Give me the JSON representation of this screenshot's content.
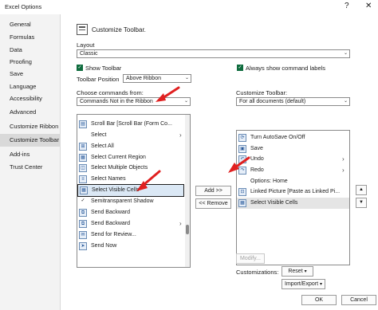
{
  "window": {
    "title": "Excel Options",
    "help": "?",
    "close": "✕"
  },
  "nav": {
    "items": [
      {
        "label": "General"
      },
      {
        "label": "Formulas"
      },
      {
        "label": "Data"
      },
      {
        "label": "Proofing"
      },
      {
        "label": "Save"
      },
      {
        "label": "Language"
      },
      {
        "label": "Accessibility"
      },
      {
        "label": "Advanced"
      },
      {
        "label": "Customize Ribbon"
      },
      {
        "label": "Customize Toolbar"
      },
      {
        "label": "Add-ins"
      },
      {
        "label": "Trust Center"
      }
    ],
    "active": "Customize Toolbar"
  },
  "main": {
    "heading": "Customize Toolbar.",
    "layout_label": "Layout",
    "layout_value": "Classic",
    "show_toolbar": "Show Toolbar",
    "always_show_labels": "Always show command labels",
    "toolbar_position_label": "Toolbar Position",
    "toolbar_position_value": "Above Ribbon",
    "choose_commands_label": "Choose commands from:",
    "choose_commands_value": "Commands Not in the Ribbon",
    "customize_toolbar_label": "Customize Toolbar:",
    "customize_toolbar_value": "For all documents (default)",
    "left_list": [
      {
        "label": "Scroll Bar [Scroll Bar (Form Co...",
        "icon": "scrollbar-icon"
      },
      {
        "label": "Select",
        "icon": "",
        "arrow": "›"
      },
      {
        "label": "Select All",
        "icon": "select-all-icon"
      },
      {
        "label": "Select Current Region",
        "icon": "select-region-icon"
      },
      {
        "label": "Select Multiple Objects",
        "icon": "select-objects-icon"
      },
      {
        "label": "Select Names",
        "icon": "select-names-icon"
      },
      {
        "label": "Select Visible Cells",
        "icon": "select-visible-cells-icon"
      },
      {
        "label": "Semitransparent Shadow",
        "icon": "check-mark-icon"
      },
      {
        "label": "Send Backward",
        "icon": "send-backward-icon"
      },
      {
        "label": "Send Backward",
        "icon": "send-backward-icon",
        "arrow": "›"
      },
      {
        "label": "Send for Review...",
        "icon": "send-review-icon"
      },
      {
        "label": "Send Now",
        "icon": "send-now-icon"
      }
    ],
    "right_list": [
      {
        "label": "Turn AutoSave On/Off",
        "icon": "autosave-icon"
      },
      {
        "label": "Save",
        "icon": "save-icon"
      },
      {
        "label": "Undo",
        "icon": "undo-icon",
        "arrow": "›"
      },
      {
        "label": "Redo",
        "icon": "redo-icon",
        "arrow": "›"
      },
      {
        "label": "Options: Home",
        "icon": ""
      },
      {
        "label": "Linked Picture [Paste as Linked Pi...",
        "icon": "linked-picture-icon"
      },
      {
        "label": "Select Visible Cells",
        "icon": "select-visible-cells-icon"
      }
    ],
    "add_button": "Add >>",
    "remove_button": "<< Remove",
    "modify_button": "Modify...",
    "customizations_label": "Customizations:",
    "reset_button": "Reset",
    "import_export_button": "Import/Export",
    "ok_button": "OK",
    "cancel_button": "Cancel"
  },
  "colors": {
    "accent": "#0f6c3e",
    "annotation_arrow": "#e02020",
    "selection": "#dbe8f5"
  }
}
